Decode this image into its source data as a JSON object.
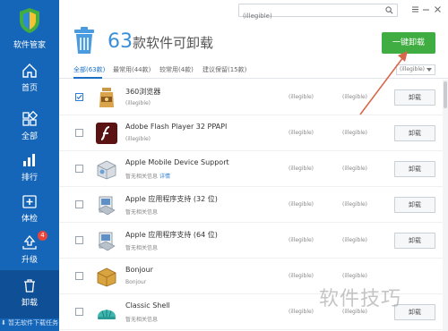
{
  "app": {
    "name": "软件管家",
    "footer_text": "暂无软件下载任务"
  },
  "nav": {
    "items": [
      {
        "label": "首页",
        "icon": "home-icon"
      },
      {
        "label": "全部",
        "icon": "grid-icon"
      },
      {
        "label": "排行",
        "icon": "ranking-icon"
      },
      {
        "label": "体检",
        "icon": "checkup-icon"
      },
      {
        "label": "升级",
        "icon": "upgrade-icon",
        "badge": "4"
      },
      {
        "label": "卸载",
        "icon": "trash-icon",
        "active": true
      }
    ]
  },
  "search": {
    "placeholder": "(illegible)"
  },
  "header": {
    "count": "63",
    "count_text": "款软件可卸载",
    "uninstall_all_label": "一键卸载"
  },
  "tabs": [
    {
      "label": "全部(63款)",
      "active": true
    },
    {
      "label": "最常用(44款)"
    },
    {
      "label": "较常用(4款)"
    },
    {
      "label": "建议保留(15款)"
    }
  ],
  "sort": {
    "selected": "(illegible)"
  },
  "apps": [
    {
      "name": "360浏览器",
      "desc": "(illegible)",
      "link": "",
      "size": "(illegible)",
      "date": "(illegible)",
      "button": "卸载",
      "checked": true,
      "icon": "browser-icon"
    },
    {
      "name": "Adobe Flash Player 32 PPAPI",
      "desc": "(illegible)",
      "link": "",
      "size": "(illegible)",
      "date": "(illegible)",
      "button": "卸载",
      "checked": false,
      "icon": "flash-icon"
    },
    {
      "name": "Apple Mobile Device Support",
      "desc": "暂无相关信息",
      "link": "详情",
      "size": "(illegible)",
      "date": "(illegible)",
      "button": "卸载",
      "checked": false,
      "icon": "installer-box-icon"
    },
    {
      "name": "Apple 应用程序支持 (32 位)",
      "desc": "暂无相关信息",
      "link": "",
      "size": "(illegible)",
      "date": "(illegible)",
      "button": "卸载",
      "checked": false,
      "icon": "installer-icon"
    },
    {
      "name": "Apple 应用程序支持 (64 位)",
      "desc": "暂无相关信息",
      "link": "",
      "size": "(illegible)",
      "date": "(illegible)",
      "button": "卸载",
      "checked": false,
      "icon": "installer-icon"
    },
    {
      "name": "Bonjour",
      "desc": "Bonjour",
      "link": "",
      "size": "(illegible)",
      "date": "(illegible)",
      "button": "",
      "checked": false,
      "icon": "bonjour-icon"
    },
    {
      "name": "Classic Shell",
      "desc": "暂无相关信息",
      "link": "",
      "size": "(illegible)",
      "date": "(illegible)",
      "button": "卸载",
      "checked": false,
      "icon": "shell-icon"
    }
  ],
  "watermark": "软件技巧",
  "colors": {
    "sidebar": "#1566b8",
    "accent": "#3a8fd6",
    "primary_button": "#3fad41",
    "annotation": "#d9674a"
  }
}
